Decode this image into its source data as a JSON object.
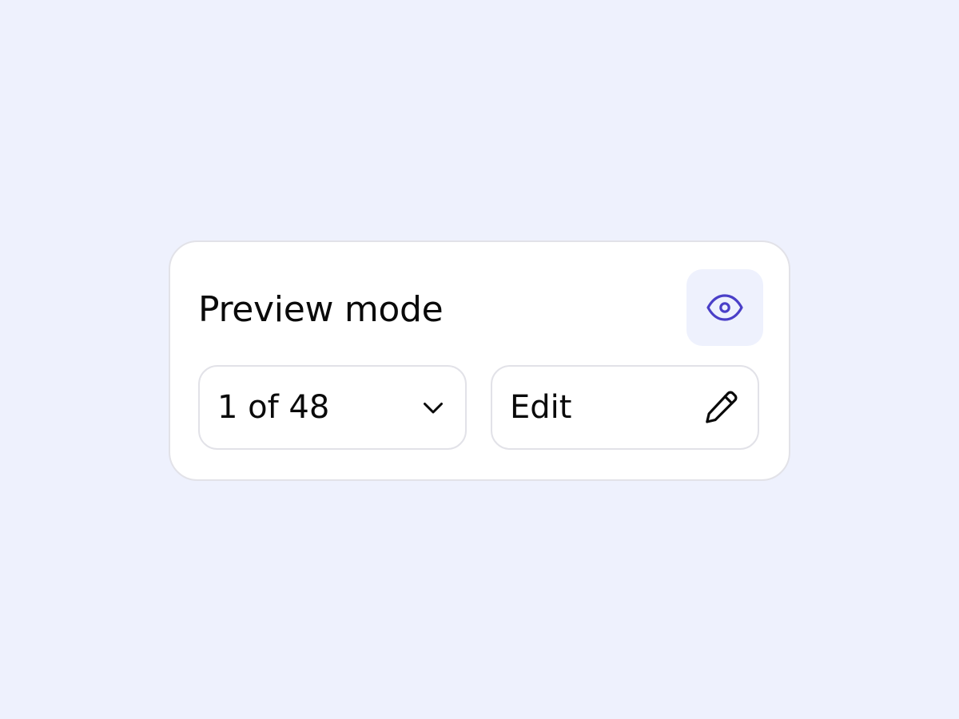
{
  "card": {
    "title": "Preview mode",
    "preview_icon": "eye-icon",
    "page_select": {
      "value": "1 of 48",
      "icon": "chevron-down-icon"
    },
    "edit_button": {
      "label": "Edit",
      "icon": "pencil-icon"
    }
  },
  "colors": {
    "background": "#eef1fd",
    "card": "#ffffff",
    "border": "#e2e2e8",
    "accent": "#4a3fc8",
    "text": "#0a0a0a"
  }
}
